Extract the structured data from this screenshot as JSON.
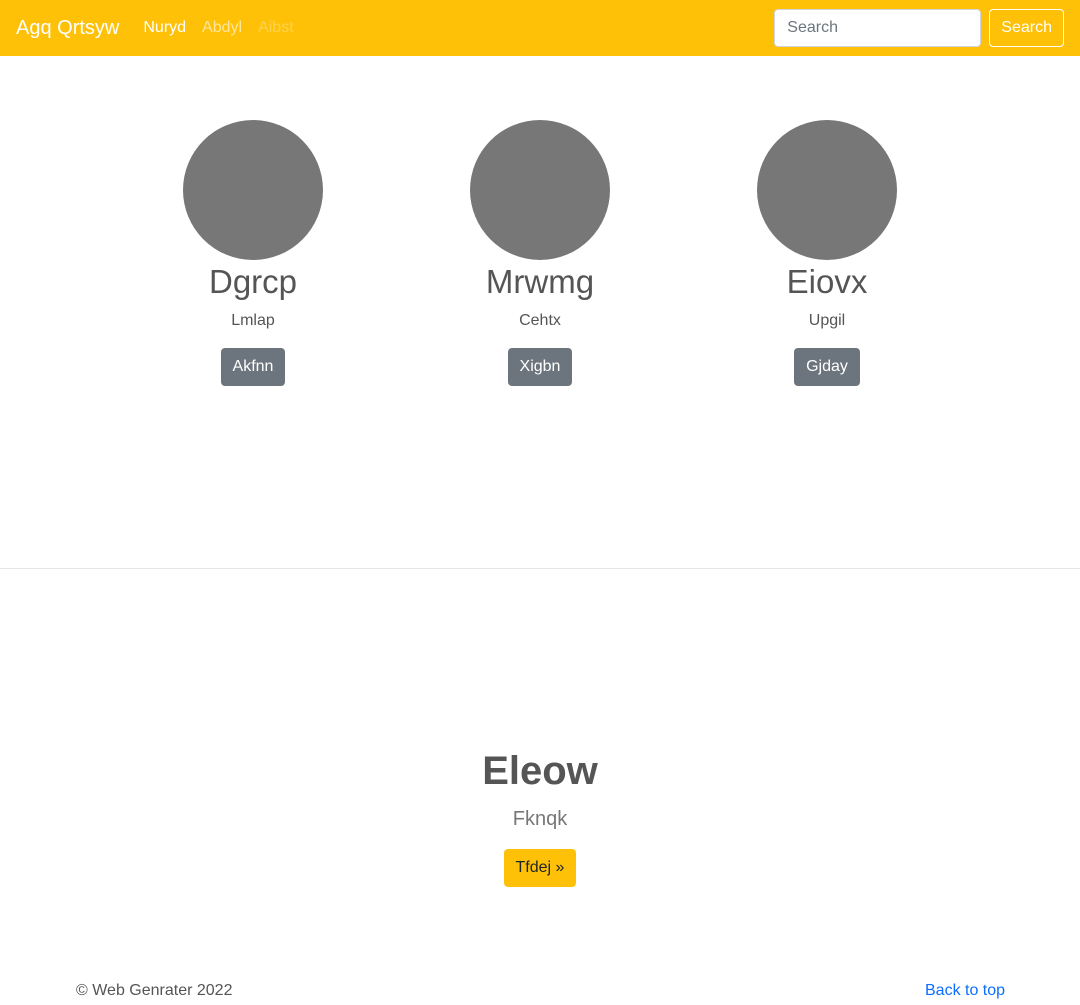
{
  "navbar": {
    "brand": "Agq Qrtsyw",
    "links": [
      {
        "label": "Nuryd",
        "state": "active"
      },
      {
        "label": "Abdyl",
        "state": "normal"
      },
      {
        "label": "Aibst",
        "state": "disabled"
      }
    ],
    "search_placeholder": "Search",
    "search_button": "Search",
    "color": "#ffc107"
  },
  "cards": [
    {
      "name": "Dgrcp",
      "subtitle": "Lmlap",
      "button": "Akfnn"
    },
    {
      "name": "Mrwmg",
      "subtitle": "Cehtx",
      "button": "Xigbn"
    },
    {
      "name": "Eiovx",
      "subtitle": "Upgil",
      "button": "Gjday"
    }
  ],
  "hero": {
    "title": "Eleow",
    "subtitle": "Fknqk",
    "button": "Tfdej »"
  },
  "footer": {
    "copyright": "© Web Genrater 2022",
    "back_to_top": "Back to top"
  }
}
